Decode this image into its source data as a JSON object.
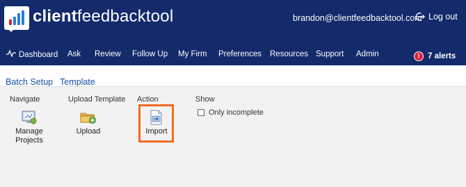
{
  "header": {
    "brand_bold": "client",
    "brand_light": "feedbacktool",
    "user_email": "brandon@clientfeedbacktool.com",
    "logout_label": "Log out",
    "logo_colors": [
      "#e01e37",
      "#2a7de1",
      "#2a7de1",
      "#2a7de1"
    ]
  },
  "nav": {
    "items": [
      {
        "label": "Dashboard",
        "icon": "pulse-icon"
      },
      {
        "label": "Ask"
      },
      {
        "label": "Review"
      },
      {
        "label": "Follow Up"
      },
      {
        "label": "My Firm"
      },
      {
        "label": "Preferences"
      },
      {
        "label": "Resources"
      },
      {
        "label": "Support"
      },
      {
        "label": "Admin"
      }
    ],
    "alerts_icon_text": "!",
    "alerts_label": "7 alerts"
  },
  "tabs": [
    {
      "label": "Batch Setup",
      "active": true
    },
    {
      "label": "Template",
      "active": false
    }
  ],
  "toolbar": {
    "navigate": {
      "label": "Navigate",
      "manage_projects_label": "Manage\nProjects"
    },
    "upload_template": {
      "label": "Upload Template",
      "upload_label": "Upload"
    },
    "action": {
      "label": "Action",
      "import_label": "Import"
    },
    "show": {
      "label": "Show",
      "only_incomplete_label": "Only incomplete",
      "only_incomplete_checked": false
    }
  },
  "colors": {
    "header_bg": "#132a6b",
    "accent_highlight": "#f26a21",
    "alert_red": "#e01e37",
    "link_blue": "#1a4fa0",
    "panel_bg": "#f2f2f2"
  }
}
